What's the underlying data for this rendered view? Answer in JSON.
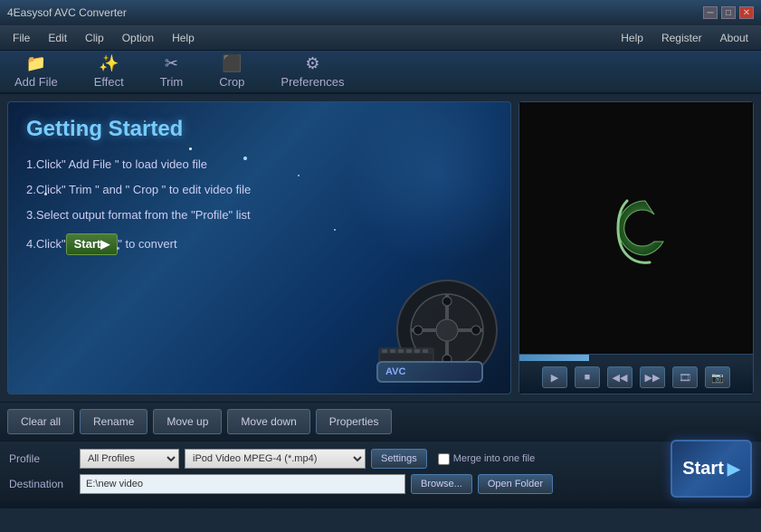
{
  "app": {
    "title": "4Easysof AVC Converter",
    "window_buttons": [
      "minimize",
      "maximize",
      "close"
    ]
  },
  "menu": {
    "items": [
      "File",
      "Edit",
      "Clip",
      "Option",
      "Help"
    ],
    "right_items": [
      "Help",
      "Register",
      "About"
    ]
  },
  "toolbar": {
    "items": [
      {
        "label": "Add File",
        "icon": "📁"
      },
      {
        "label": "Effect",
        "icon": "✨"
      },
      {
        "label": "Trim",
        "icon": "✂"
      },
      {
        "label": "Crop",
        "icon": "⬛"
      },
      {
        "label": "Preferences",
        "icon": "⚙"
      }
    ]
  },
  "getting_started": {
    "title": "Getting Started",
    "steps": [
      "1.Click\" Add File \" to load video file",
      "2.Click\" Trim \" and \" Crop \" to edit video file",
      "3.Select output format from the \"Profile\" list",
      "4.Click\""
    ],
    "step4_suffix": "\" to convert",
    "start_label": "Start▶"
  },
  "action_buttons": {
    "clear_all": "Clear all",
    "rename": "Rename",
    "move_up": "Move up",
    "move_down": "Move down",
    "properties": "Properties"
  },
  "profile": {
    "label": "Profile",
    "profile_options": [
      "All Profiles"
    ],
    "format_options": [
      "iPod Video MPEG-4 (*.mp4)"
    ],
    "settings_label": "Settings",
    "merge_label": "Merge into one file"
  },
  "destination": {
    "label": "Destination",
    "value": "E:\\new video",
    "browse_label": "Browse...",
    "open_folder_label": "Open Folder"
  },
  "start_button": {
    "label": "Start",
    "arrow": "▶"
  },
  "preview": {
    "controls": [
      "▶",
      "■",
      "◀◀",
      "▶▶",
      "📋",
      "📷"
    ]
  }
}
